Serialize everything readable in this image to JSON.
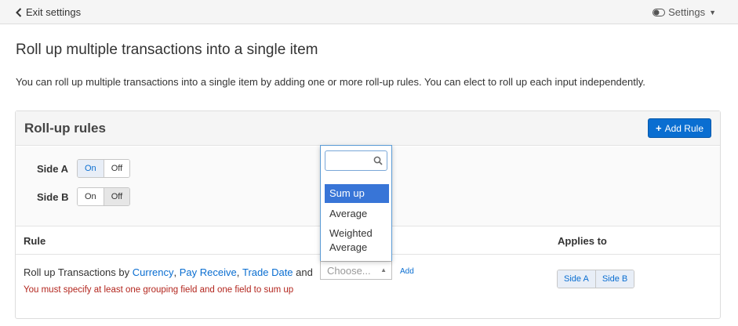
{
  "topbar": {
    "exit_label": "Exit settings",
    "settings_label": "Settings"
  },
  "page": {
    "title": "Roll up multiple transactions into a single item",
    "intro": "You can roll up multiple transactions into a single item by adding one or more roll-up rules. You can elect to roll up each input independently."
  },
  "panel": {
    "title": "Roll-up rules",
    "add_rule_label": "Add Rule",
    "sides": [
      {
        "label": "Side A",
        "on": "On",
        "off": "Off",
        "selected": "On"
      },
      {
        "label": "Side B",
        "on": "On",
        "off": "Off",
        "selected": "Off"
      }
    ]
  },
  "table": {
    "col_rule": "Rule",
    "col_applies": "Applies to",
    "rule": {
      "prefix": "Roll up Transactions by",
      "fields": [
        "Currency",
        "Pay Receive",
        "Trade Date"
      ],
      "separator": ",",
      "suffix": "and",
      "choose_placeholder": "Choose...",
      "add_label": "Add",
      "error": "You must specify at least one grouping field and one field to sum up",
      "applies": [
        "Side A",
        "Side B"
      ]
    }
  },
  "dropdown": {
    "search_value": "",
    "options": [
      "Sum up",
      "Average",
      "Weighted Average"
    ],
    "highlighted": "Sum up"
  },
  "colors": {
    "accent": "#0a6ed1",
    "error": "#b3261e",
    "highlight": "#3875d7"
  }
}
